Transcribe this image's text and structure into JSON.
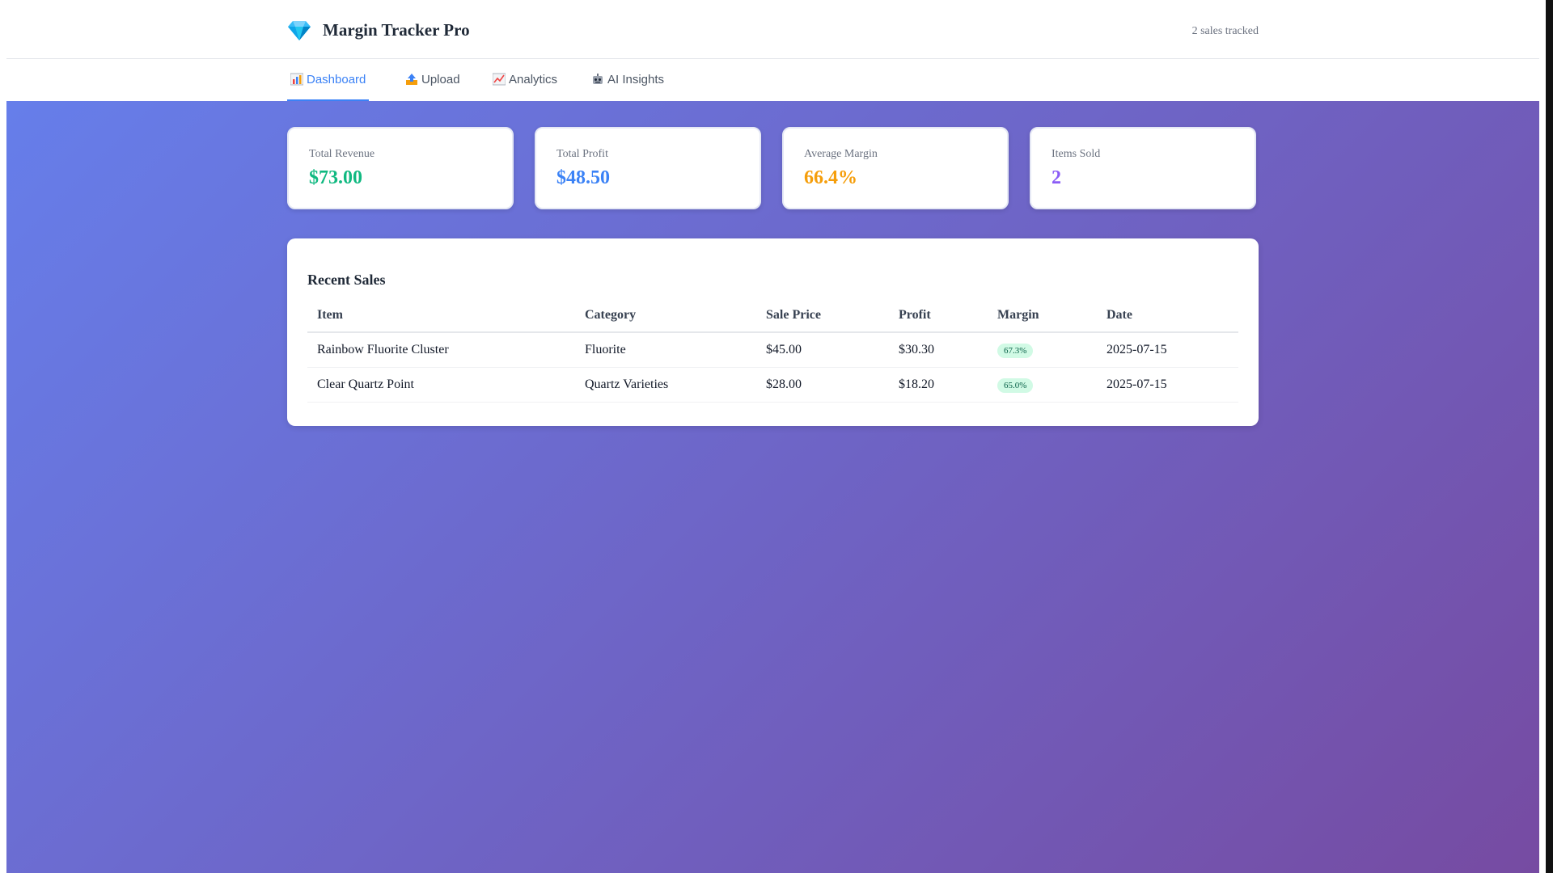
{
  "app": {
    "title": "Margin Tracker Pro",
    "sales_tracked": "2 sales tracked"
  },
  "tabs": [
    {
      "label": "Dashboard",
      "icon": "bar-chart-icon",
      "active": true
    },
    {
      "label": "Upload",
      "icon": "upload-icon",
      "active": false
    },
    {
      "label": "Analytics",
      "icon": "line-chart-icon",
      "active": false
    },
    {
      "label": "AI Insights",
      "icon": "robot-icon",
      "active": false
    }
  ],
  "stats": [
    {
      "label": "Total Revenue",
      "value": "$73.00",
      "color": "#10b981"
    },
    {
      "label": "Total Profit",
      "value": "$48.50",
      "color": "#3b82f6"
    },
    {
      "label": "Average Margin",
      "value": "66.4%",
      "color": "#f59e0b"
    },
    {
      "label": "Items Sold",
      "value": "2",
      "color": "#8b5cf6"
    }
  ],
  "recent_sales": {
    "title": "Recent Sales",
    "columns": [
      "Item",
      "Category",
      "Sale Price",
      "Profit",
      "Margin",
      "Date"
    ],
    "rows": [
      {
        "item": "Rainbow Fluorite Cluster",
        "category": "Fluorite",
        "sale_price": "$45.00",
        "profit": "$30.30",
        "margin": "67.3%",
        "date": "2025-07-15"
      },
      {
        "item": "Clear Quartz Point",
        "category": "Quartz Varieties",
        "sale_price": "$28.00",
        "profit": "$18.20",
        "margin": "65.0%",
        "date": "2025-07-15"
      }
    ]
  },
  "colors": {
    "accent": "#3b82f6",
    "gradient_start": "#667eea",
    "gradient_end": "#764ba2"
  }
}
